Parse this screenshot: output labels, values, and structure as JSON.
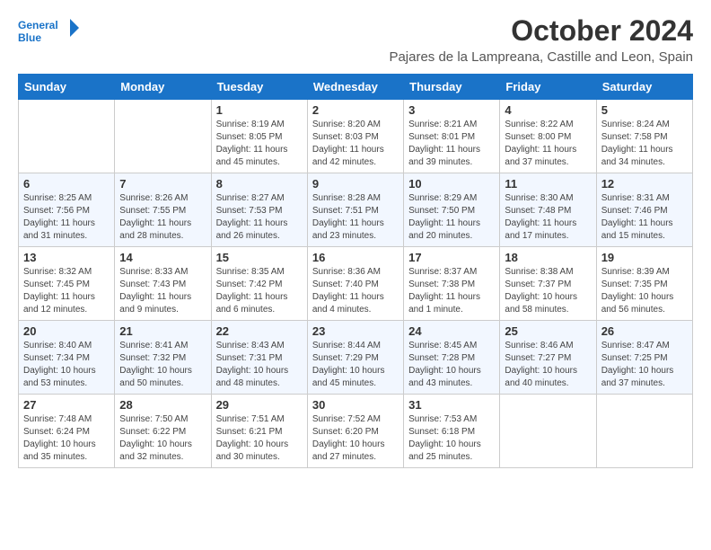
{
  "logo": {
    "line1": "General",
    "line2": "Blue"
  },
  "title": "October 2024",
  "subtitle": "Pajares de la Lampreana, Castille and Leon, Spain",
  "columns": [
    "Sunday",
    "Monday",
    "Tuesday",
    "Wednesday",
    "Thursday",
    "Friday",
    "Saturday"
  ],
  "weeks": [
    [
      {
        "day": "",
        "info": ""
      },
      {
        "day": "",
        "info": ""
      },
      {
        "day": "1",
        "info": "Sunrise: 8:19 AM\nSunset: 8:05 PM\nDaylight: 11 hours and 45 minutes."
      },
      {
        "day": "2",
        "info": "Sunrise: 8:20 AM\nSunset: 8:03 PM\nDaylight: 11 hours and 42 minutes."
      },
      {
        "day": "3",
        "info": "Sunrise: 8:21 AM\nSunset: 8:01 PM\nDaylight: 11 hours and 39 minutes."
      },
      {
        "day": "4",
        "info": "Sunrise: 8:22 AM\nSunset: 8:00 PM\nDaylight: 11 hours and 37 minutes."
      },
      {
        "day": "5",
        "info": "Sunrise: 8:24 AM\nSunset: 7:58 PM\nDaylight: 11 hours and 34 minutes."
      }
    ],
    [
      {
        "day": "6",
        "info": "Sunrise: 8:25 AM\nSunset: 7:56 PM\nDaylight: 11 hours and 31 minutes."
      },
      {
        "day": "7",
        "info": "Sunrise: 8:26 AM\nSunset: 7:55 PM\nDaylight: 11 hours and 28 minutes."
      },
      {
        "day": "8",
        "info": "Sunrise: 8:27 AM\nSunset: 7:53 PM\nDaylight: 11 hours and 26 minutes."
      },
      {
        "day": "9",
        "info": "Sunrise: 8:28 AM\nSunset: 7:51 PM\nDaylight: 11 hours and 23 minutes."
      },
      {
        "day": "10",
        "info": "Sunrise: 8:29 AM\nSunset: 7:50 PM\nDaylight: 11 hours and 20 minutes."
      },
      {
        "day": "11",
        "info": "Sunrise: 8:30 AM\nSunset: 7:48 PM\nDaylight: 11 hours and 17 minutes."
      },
      {
        "day": "12",
        "info": "Sunrise: 8:31 AM\nSunset: 7:46 PM\nDaylight: 11 hours and 15 minutes."
      }
    ],
    [
      {
        "day": "13",
        "info": "Sunrise: 8:32 AM\nSunset: 7:45 PM\nDaylight: 11 hours and 12 minutes."
      },
      {
        "day": "14",
        "info": "Sunrise: 8:33 AM\nSunset: 7:43 PM\nDaylight: 11 hours and 9 minutes."
      },
      {
        "day": "15",
        "info": "Sunrise: 8:35 AM\nSunset: 7:42 PM\nDaylight: 11 hours and 6 minutes."
      },
      {
        "day": "16",
        "info": "Sunrise: 8:36 AM\nSunset: 7:40 PM\nDaylight: 11 hours and 4 minutes."
      },
      {
        "day": "17",
        "info": "Sunrise: 8:37 AM\nSunset: 7:38 PM\nDaylight: 11 hours and 1 minute."
      },
      {
        "day": "18",
        "info": "Sunrise: 8:38 AM\nSunset: 7:37 PM\nDaylight: 10 hours and 58 minutes."
      },
      {
        "day": "19",
        "info": "Sunrise: 8:39 AM\nSunset: 7:35 PM\nDaylight: 10 hours and 56 minutes."
      }
    ],
    [
      {
        "day": "20",
        "info": "Sunrise: 8:40 AM\nSunset: 7:34 PM\nDaylight: 10 hours and 53 minutes."
      },
      {
        "day": "21",
        "info": "Sunrise: 8:41 AM\nSunset: 7:32 PM\nDaylight: 10 hours and 50 minutes."
      },
      {
        "day": "22",
        "info": "Sunrise: 8:43 AM\nSunset: 7:31 PM\nDaylight: 10 hours and 48 minutes."
      },
      {
        "day": "23",
        "info": "Sunrise: 8:44 AM\nSunset: 7:29 PM\nDaylight: 10 hours and 45 minutes."
      },
      {
        "day": "24",
        "info": "Sunrise: 8:45 AM\nSunset: 7:28 PM\nDaylight: 10 hours and 43 minutes."
      },
      {
        "day": "25",
        "info": "Sunrise: 8:46 AM\nSunset: 7:27 PM\nDaylight: 10 hours and 40 minutes."
      },
      {
        "day": "26",
        "info": "Sunrise: 8:47 AM\nSunset: 7:25 PM\nDaylight: 10 hours and 37 minutes."
      }
    ],
    [
      {
        "day": "27",
        "info": "Sunrise: 7:48 AM\nSunset: 6:24 PM\nDaylight: 10 hours and 35 minutes."
      },
      {
        "day": "28",
        "info": "Sunrise: 7:50 AM\nSunset: 6:22 PM\nDaylight: 10 hours and 32 minutes."
      },
      {
        "day": "29",
        "info": "Sunrise: 7:51 AM\nSunset: 6:21 PM\nDaylight: 10 hours and 30 minutes."
      },
      {
        "day": "30",
        "info": "Sunrise: 7:52 AM\nSunset: 6:20 PM\nDaylight: 10 hours and 27 minutes."
      },
      {
        "day": "31",
        "info": "Sunrise: 7:53 AM\nSunset: 6:18 PM\nDaylight: 10 hours and 25 minutes."
      },
      {
        "day": "",
        "info": ""
      },
      {
        "day": "",
        "info": ""
      }
    ]
  ]
}
